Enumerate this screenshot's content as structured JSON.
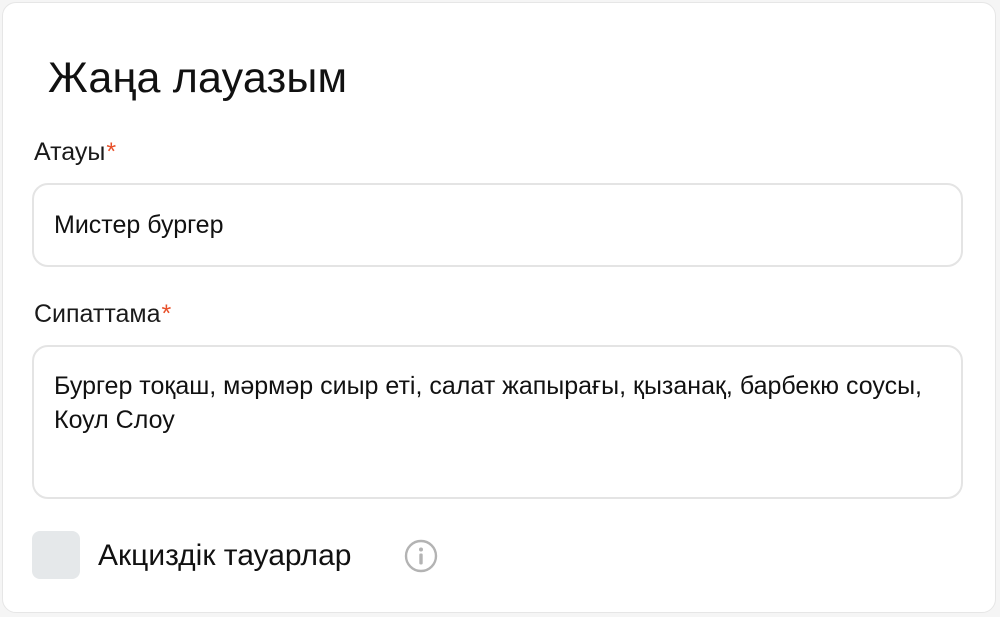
{
  "form": {
    "title": "Жаңа лауазым",
    "name_field": {
      "label": "Атауы",
      "required_mark": "*",
      "value": "Мистер бургер"
    },
    "description_field": {
      "label": "Сипаттама",
      "required_mark": "*",
      "value": "Бургер тоқаш, мәрмәр сиыр еті, салат жапырағы, қызанақ, барбекю соусы, Коул Слоу"
    },
    "excise_checkbox": {
      "label": "Акциздік тауарлар",
      "checked": false,
      "info_icon": "info-icon"
    }
  },
  "colors": {
    "required_mark": "#e8502a",
    "field_border": "#e4e4e4",
    "checkbox_bg": "#e5e8ea",
    "info_icon": "#b3b3b3"
  }
}
